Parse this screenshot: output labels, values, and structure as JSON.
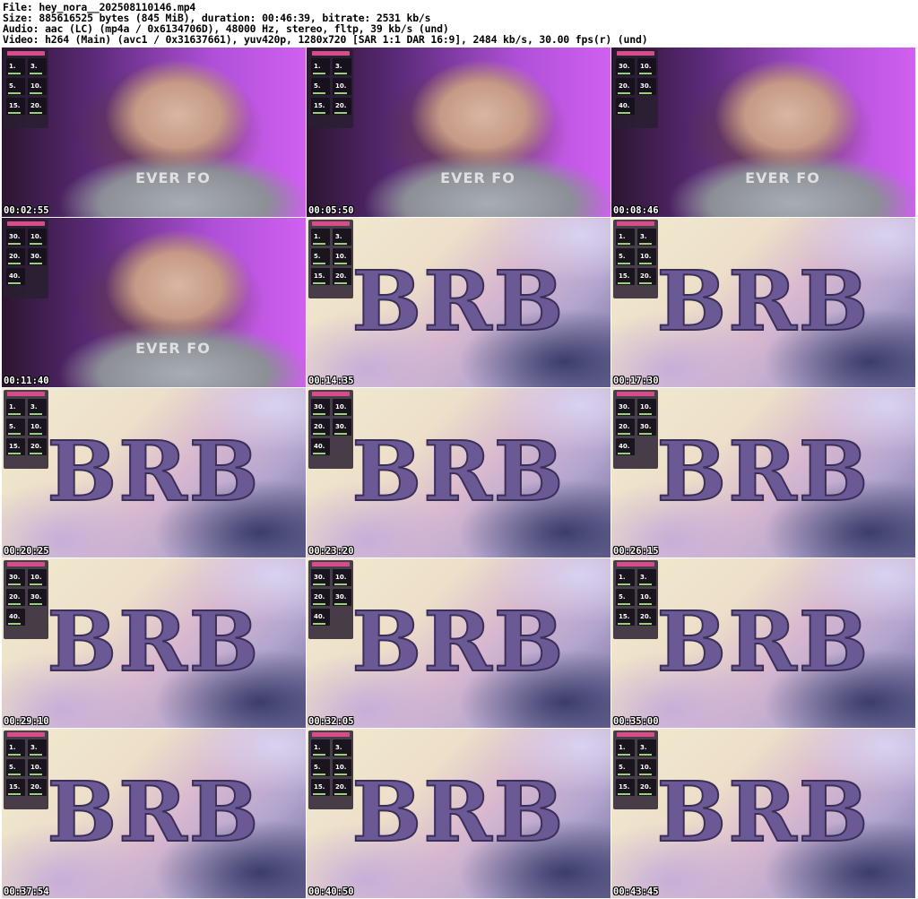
{
  "header": {
    "file_line": "File: hey_nora__202508110146.mp4",
    "size_line": "Size: 885616525 bytes (845 MiB), duration: 00:46:39, bitrate: 2531 kb/s",
    "audio_line": "Audio: aac (LC) (mp4a / 0x6134706D), 48000 Hz, stereo, fltp, 39 kb/s (und)",
    "video_line": "Video: h264 (Main) (avc1 / 0x31637661), yuv420p, 1280x720 [SAR 1:1 DAR 16:9], 2484 kb/s, 30.00 fps(r) (und)"
  },
  "colors": {
    "cam_bg": "#b050d8",
    "brb_text": "#6b5996",
    "panel_accent": "#d94c8a"
  },
  "frames": [
    {
      "timestamp": "00:02:55",
      "scene": "webcam",
      "overlay": [
        "1.",
        "3.",
        "5.",
        "10.",
        "15.",
        "20."
      ]
    },
    {
      "timestamp": "00:05:50",
      "scene": "webcam",
      "overlay": [
        "1.",
        "3.",
        "5.",
        "10.",
        "15.",
        "20."
      ]
    },
    {
      "timestamp": "00:08:46",
      "scene": "webcam",
      "overlay": [
        "30.",
        "10.",
        "20.",
        "30.",
        "40."
      ]
    },
    {
      "timestamp": "00:11:40",
      "scene": "webcam",
      "overlay": [
        "30.",
        "10.",
        "20.",
        "30.",
        "40."
      ]
    },
    {
      "timestamp": "00:14:35",
      "scene": "brb",
      "overlay": [
        "1.",
        "3.",
        "5.",
        "10.",
        "15.",
        "20."
      ]
    },
    {
      "timestamp": "00:17:30",
      "scene": "brb",
      "overlay": [
        "1.",
        "3.",
        "5.",
        "10.",
        "15.",
        "20."
      ]
    },
    {
      "timestamp": "00:20:25",
      "scene": "brb",
      "overlay": [
        "1.",
        "3.",
        "5.",
        "10.",
        "15.",
        "20."
      ]
    },
    {
      "timestamp": "00:23:20",
      "scene": "brb",
      "overlay": [
        "30.",
        "10.",
        "20.",
        "30.",
        "40."
      ]
    },
    {
      "timestamp": "00:26:15",
      "scene": "brb",
      "overlay": [
        "30.",
        "10.",
        "20.",
        "30.",
        "40."
      ]
    },
    {
      "timestamp": "00:29:10",
      "scene": "brb",
      "overlay": [
        "30.",
        "10.",
        "20.",
        "30.",
        "40."
      ]
    },
    {
      "timestamp": "00:32:05",
      "scene": "brb",
      "overlay": [
        "30.",
        "10.",
        "20.",
        "30.",
        "40."
      ]
    },
    {
      "timestamp": "00:35:00",
      "scene": "brb",
      "overlay": [
        "1.",
        "3.",
        "5.",
        "10.",
        "15.",
        "20."
      ]
    },
    {
      "timestamp": "00:37:54",
      "scene": "brb",
      "overlay": [
        "1.",
        "3.",
        "5.",
        "10.",
        "15.",
        "20."
      ]
    },
    {
      "timestamp": "00:40:50",
      "scene": "brb",
      "overlay": [
        "1.",
        "3.",
        "5.",
        "10.",
        "15.",
        "20."
      ]
    },
    {
      "timestamp": "00:43:45",
      "scene": "brb",
      "overlay": [
        "1.",
        "3.",
        "5.",
        "10.",
        "15.",
        "20."
      ]
    }
  ],
  "brb_label": "BRB",
  "shirt_text": "EVER FO"
}
